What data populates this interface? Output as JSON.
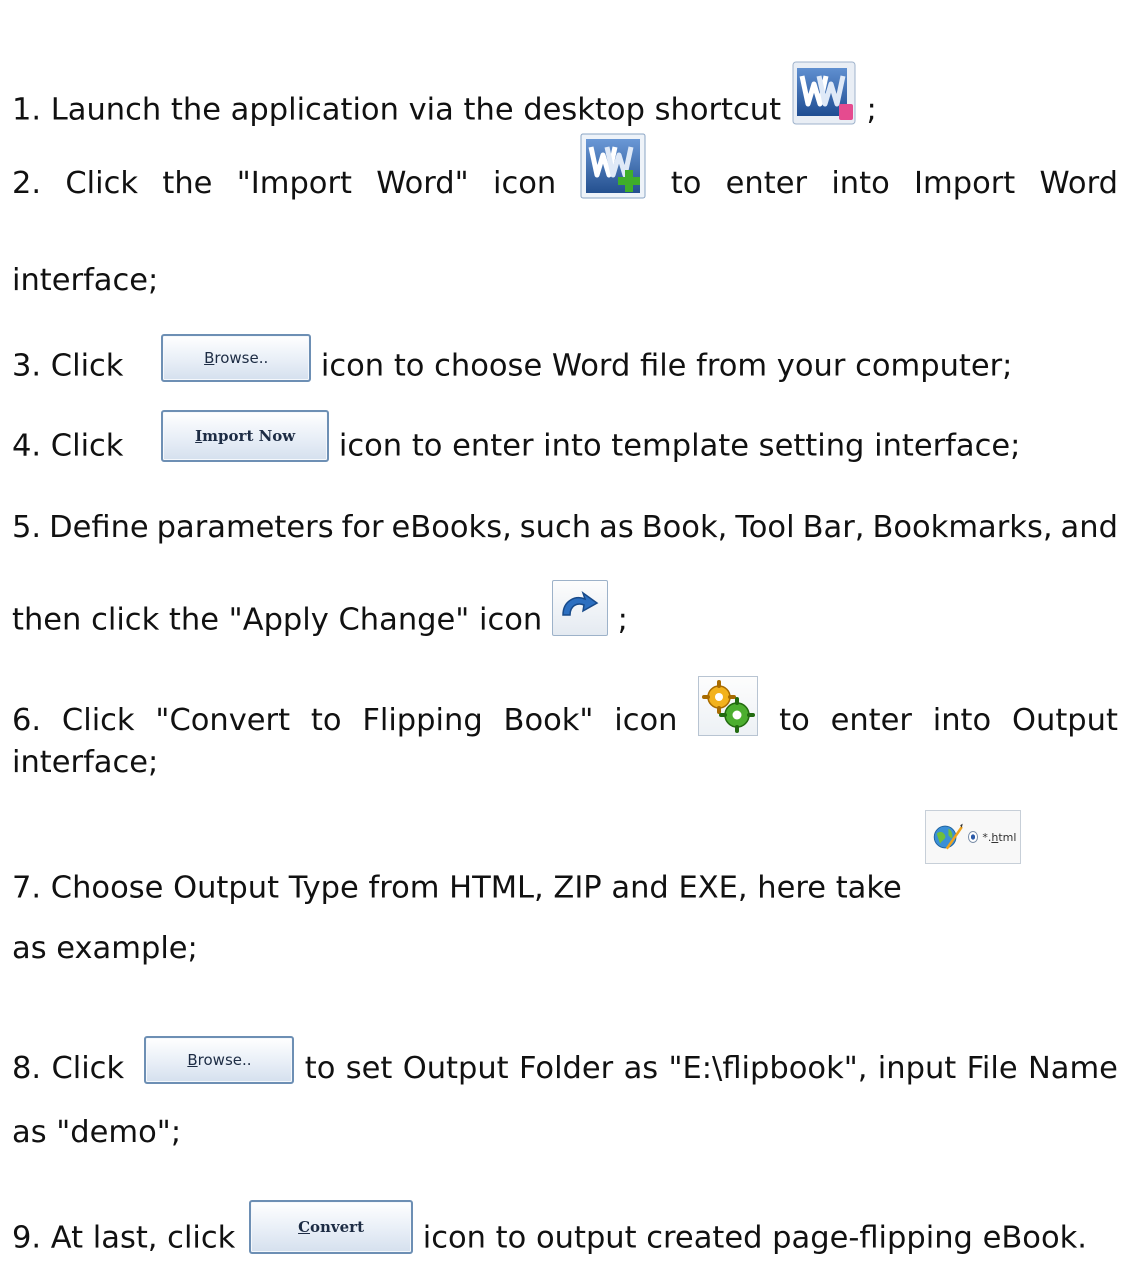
{
  "steps": {
    "s1": {
      "before": "1. Launch the application via the desktop shortcut",
      "after": ";"
    },
    "s2": {
      "w1": "2.",
      "w2": "Click",
      "w3": "the",
      "w4": "\"Import",
      "w5": "Word\"",
      "w6": "icon",
      "w7": "to",
      "w8": "enter",
      "w9": "into",
      "w10": "Import",
      "w11": "Word",
      "line2": "interface;"
    },
    "s3": {
      "before": "3. Click",
      "after": "icon to choose Word file from your computer;"
    },
    "s4": {
      "before": "4. Click",
      "after": "icon to enter into template setting interface;"
    },
    "s5": {
      "w1": "5.",
      "w2": "Define",
      "w3": "parameters",
      "w4": "for",
      "w5": "eBooks,",
      "w6": "such",
      "w7": "as",
      "w8": "Book,",
      "w9": "Tool",
      "w10": "Bar,",
      "w11": "Bookmarks,",
      "w12": "and",
      "line2_before": "then click the \"Apply Change\" icon",
      "line2_after": ";"
    },
    "s6": {
      "w1": "6.",
      "w2": "Click",
      "w3": "\"Convert",
      "w4": "to",
      "w5": "Flipping",
      "w6": "Book\"",
      "w7": "icon",
      "w8": "to",
      "w9": "enter",
      "w10": "into",
      "w11": "Output",
      "line2": "interface;"
    },
    "s7": {
      "before": "7. Choose Output Type from HTML, ZIP and EXE, here take",
      "line2": "as example;"
    },
    "s8": {
      "w1": "8.",
      "w2": "Click",
      "w3": "to",
      "w4": "set",
      "w5": "Output",
      "w6": "Folder",
      "w7": "as",
      "w8": "\"E:\\flipbook\",",
      "w9": "input",
      "w10": "File",
      "w11": "Name",
      "line2": "as \"demo\";"
    },
    "s9": {
      "before": "9. At last, click",
      "after": "icon to output created page-flipping eBook."
    }
  },
  "buttons": {
    "browse1": {
      "first": "B",
      "rest": "rowse.."
    },
    "import_now": {
      "first": "I",
      "rest": "mport Now"
    },
    "html_option": {
      "pre": "*.",
      "accel": "h",
      "rest": "tml"
    },
    "browse2": {
      "first": "B",
      "rest": "rowse.."
    },
    "convert": {
      "first": "C",
      "rest": "onvert"
    }
  },
  "icons": {
    "shortcut": "word-desktop-shortcut-icon",
    "import_word": "import-word-icon",
    "apply_change": "apply-change-icon",
    "convert_flipping": "convert-to-flipping-book-icon",
    "html_globe": "globe-html-icon"
  },
  "colors": {
    "text": "#111111",
    "button_border": "#6d8fb4",
    "word_blue": "#2f5fa8",
    "plus_green": "#3fae2a"
  }
}
